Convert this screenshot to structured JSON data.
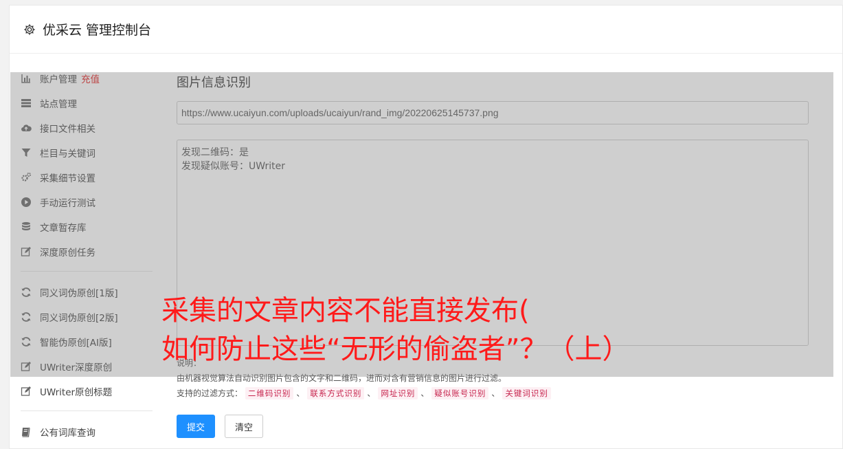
{
  "header": {
    "title": "优采云 管理控制台",
    "icon": "gear-icon"
  },
  "sidebar": {
    "group1": [
      {
        "label": "账户管理",
        "badge": "充值",
        "icon": "bar-chart-icon"
      },
      {
        "label": "站点管理",
        "icon": "server-icon"
      },
      {
        "label": "接口文件相关",
        "icon": "cloud-upload-icon"
      },
      {
        "label": "栏目与关键词",
        "icon": "filter-icon"
      },
      {
        "label": "采集细节设置",
        "icon": "cogs-icon"
      },
      {
        "label": "手动运行测试",
        "icon": "play-circle-icon"
      },
      {
        "label": "文章暂存库",
        "icon": "database-icon"
      },
      {
        "label": "深度原创任务",
        "icon": "edit-icon"
      }
    ],
    "group2": [
      {
        "label": "同义词伪原创[1版]",
        "icon": "refresh-icon"
      },
      {
        "label": "同义词伪原创[2版]",
        "icon": "refresh-icon"
      },
      {
        "label": "智能伪原创[AI版]",
        "icon": "refresh-icon"
      },
      {
        "label": "UWriter深度原创",
        "icon": "edit-icon"
      },
      {
        "label": "UWriter原创标题",
        "icon": "edit-icon"
      }
    ],
    "group3": [
      {
        "label": "公有词库查询",
        "icon": "book-icon"
      }
    ]
  },
  "main": {
    "section_title": "图片信息识别",
    "url_value": "https://www.ucaiyun.com/uploads/ucaiyun/rand_img/20220625145737.png",
    "result_lines": [
      "发现二维码：是",
      "发现疑似账号：UWriter"
    ],
    "notes": {
      "heading": "说明：",
      "description": "由机器视觉算法自动识别图片包含的文字和二维码，进而对含有营销信息的图片进行过滤。",
      "filters_label": "支持的过滤方式：",
      "filters": [
        "二维码识别",
        "联系方式识别",
        "网址识别",
        "疑似账号识别",
        "关键词识别"
      ],
      "separator": "、"
    },
    "submit_label": "提交",
    "clear_label": "清空"
  },
  "overlay": {
    "line1": "采集的文章内容不能直接发布(",
    "line2": "如何防止这些“无形的偷盗者”？（上）"
  },
  "colors": {
    "primary": "#1e90ff",
    "badge": "#e02020",
    "overlay_text": "#ff1a1a",
    "tag_text": "#c7254e"
  }
}
